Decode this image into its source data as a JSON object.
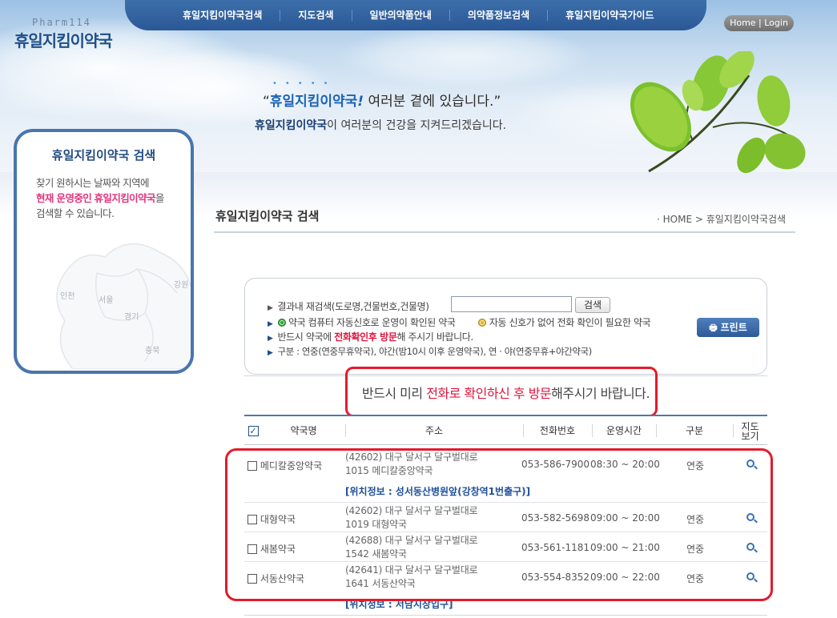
{
  "logo": {
    "sub": "Pharm114",
    "main": "휴일지킴이약국"
  },
  "nav": {
    "items": [
      "휴일지킴이약국검색",
      "지도검색",
      "일반의약품안내",
      "의약품정보검색",
      "휴일지킴이약국가이드"
    ],
    "home_login": "Home | Login"
  },
  "slogan": {
    "line1_accent": "휴일지킴이약국",
    "line1_mark": "!",
    "line1_rest": " 여러분 곁에 있습니다.",
    "open_quote": "“",
    "close_quote": "”",
    "line2_accent": "휴일지킴이약국",
    "line2_rest": "이 여러분의 건강을 지켜드리겠습니다."
  },
  "side": {
    "title": "휴일지킴이약국 검색",
    "desc_1": "찾기 원하시는 날짜와 지역에",
    "desc_2_hl1": "현재 운영중인",
    "desc_2_hl2": "휴일지킴이약국",
    "desc_2_rest": "을",
    "desc_3": "검색할 수 있습니다.",
    "map_labels": {
      "incheon": "인천",
      "seoul": "서울",
      "gangwon": "강원",
      "gyeonggi": "경기",
      "chungbuk": "충북"
    }
  },
  "content": {
    "title": "휴일지킴이약국 검색",
    "breadcrumb": "· HOME > 휴일지킴이약국검색"
  },
  "filter": {
    "research_label": "결과내 재검색(도로명,건물번호,건물명)",
    "search_value": "",
    "search_button": "검색",
    "legend_green": "약국 컴퓨터 자동신호로 운영이 확인된 약국",
    "legend_yellow": "자동 신호가 없어 전화 확인이 필요한 약국",
    "visit_pre": "반드시 약국에 ",
    "visit_red": "전화확인후 방문",
    "visit_post": "해 주시기 바랍니다.",
    "legend_type": "구분 : 연중(연중무휴약국), 야간(밤10시 이후 운영약국), 연 · 야(연중무휴+야간약국)",
    "print_button": "프린트"
  },
  "notice": {
    "pre": "반드시 미리 ",
    "red": "전화로 확인하신 후 방문",
    "post": "해주시기 바랍니다."
  },
  "table": {
    "headers": {
      "name": "약국명",
      "addr": "주소",
      "phone": "전화번호",
      "hours": "운영시간",
      "type": "구분",
      "map_1": "지도",
      "map_2": "보기"
    },
    "rows": [
      {
        "name": "메디칼중앙약국",
        "addr1": "(42602) 대구 달서구 달구벌대로",
        "addr2": "1015 메디칼중앙약국",
        "phone": "053-586-7900",
        "hours": "08:30 ~ 20:00",
        "type": "연중",
        "loc": "[위치정보 : 성서동산병원앞(강창역1번출구)]"
      },
      {
        "name": "대형약국",
        "addr1": "(42602) 대구 달서구 달구벌대로",
        "addr2": "1019 대형약국",
        "phone": "053-582-5698",
        "hours": "09:00 ~ 20:00",
        "type": "연중"
      },
      {
        "name": "새봄약국",
        "addr1": "(42688) 대구 달서구 달구벌대로",
        "addr2": "1542 새봄약국",
        "phone": "053-561-1181",
        "hours": "09:00 ~ 21:00",
        "type": "연중"
      },
      {
        "name": "서동산약국",
        "addr1": "(42641) 대구 달서구 달구벌대로",
        "addr2": "1641 서동산약국",
        "phone": "053-554-8352",
        "hours": "09:00 ~ 22:00",
        "type": "연중",
        "loc": "[위치정보 : 서남시장입구]"
      }
    ]
  },
  "colors": {
    "brand": "#2a5896",
    "accent_red": "#e0143c",
    "highlight_pink": "#e2357e"
  }
}
